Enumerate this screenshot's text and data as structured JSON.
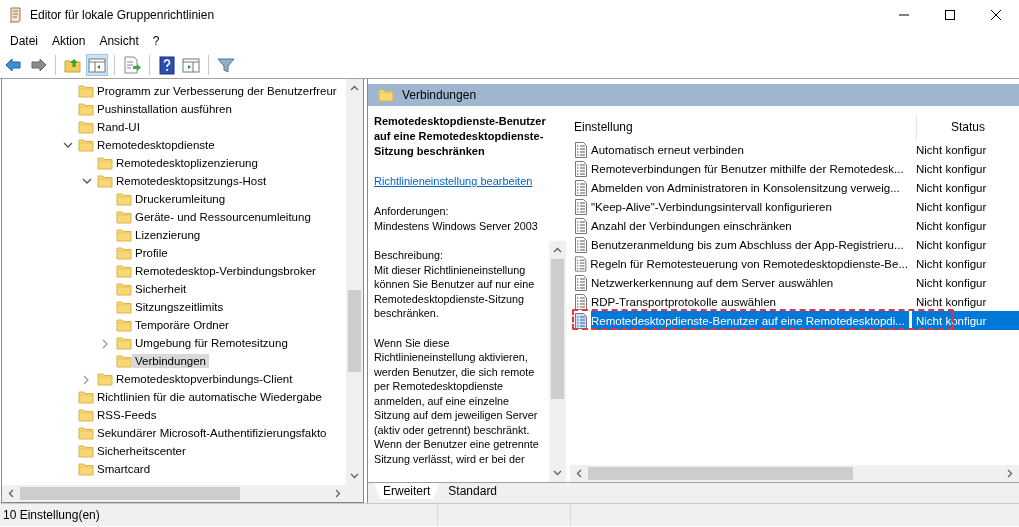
{
  "window": {
    "title": "Editor für lokale Gruppenrichtlinien"
  },
  "menu": [
    "Datei",
    "Aktion",
    "Ansicht",
    "?"
  ],
  "toolbar": [
    {
      "kind": "back"
    },
    {
      "kind": "forward"
    },
    {
      "kind": "sep"
    },
    {
      "kind": "up"
    },
    {
      "kind": "pane",
      "selected": true
    },
    {
      "kind": "sep"
    },
    {
      "kind": "export"
    },
    {
      "kind": "sep"
    },
    {
      "kind": "help"
    },
    {
      "kind": "pane2",
      "selected": false
    },
    {
      "kind": "sep"
    },
    {
      "kind": "filter"
    }
  ],
  "tree": [
    {
      "label": "Programm zur Verbesserung der Benutzerfreur",
      "selected": false
    },
    {
      "label": "Pushinstallation ausführen",
      "selected": false
    },
    {
      "label": "Rand-UI",
      "selected": false
    },
    {
      "label": "Remotedesktopdienste",
      "selected": false,
      "expanded": true,
      "children": [
        {
          "label": "Remotedesktoplizenzierung",
          "selected": false
        },
        {
          "label": "Remotedesktopsitzungs-Host",
          "selected": false,
          "expanded": true,
          "children": [
            {
              "label": "Druckerumleitung",
              "selected": false
            },
            {
              "label": "Geräte- und Ressourcenumleitung",
              "selected": false
            },
            {
              "label": "Lizenzierung",
              "selected": false
            },
            {
              "label": "Profile",
              "selected": false
            },
            {
              "label": "Remotedesktop-Verbindungsbroker",
              "selected": false
            },
            {
              "label": "Sicherheit",
              "selected": false
            },
            {
              "label": "Sitzungszeitlimits",
              "selected": false
            },
            {
              "label": "Temporäre Ordner",
              "selected": false
            },
            {
              "label": "Umgebung für Remotesitzung",
              "selected": false,
              "expanded": false
            },
            {
              "label": "Verbindungen",
              "selected": true
            }
          ]
        },
        {
          "label": "Remotedesktopverbindungs-Client",
          "selected": false,
          "expanded": false
        }
      ]
    },
    {
      "label": "Richtlinien für die automatische Wiedergabe",
      "selected": false
    },
    {
      "label": "RSS-Feeds",
      "selected": false
    },
    {
      "label": "Sekundärer Microsoft-Authentifizierungsfakto",
      "selected": false
    },
    {
      "label": "Sicherheitscenter",
      "selected": false
    },
    {
      "label": "Smartcard",
      "selected": false
    }
  ],
  "panel_header": "Verbindungen",
  "description": {
    "title": "Remotedesktopdienste-Benutzer auf eine Remotedesktopdienste-Sitzung beschränken",
    "link": "Richtlinieneinstellung bearbeiten",
    "paragraphs": [
      "Anforderungen:\nMindestens Windows Server 2003",
      "Beschreibung:\nMit dieser Richtlinieneinstellung können Sie Benutzer auf nur eine Remotedesktopdienste-Sitzung beschränken.",
      "Wenn Sie diese Richtlinieneinstellung aktivieren, werden Benutzer, die sich remote per Remotedesktopdienste anmelden, auf eine einzelne Sitzung auf dem jeweiligen Server (aktiv oder getrennt) beschränkt. Wenn der Benutzer eine getrennte Sitzung verlässt, wird er bei der"
    ]
  },
  "table": {
    "columns": [
      "Einstellung",
      "Status"
    ],
    "rows": [
      {
        "setting": "Automatisch erneut verbinden",
        "status": "Nicht konfigur",
        "selected": false
      },
      {
        "setting": "Remoteverbindungen für Benutzer mithilfe der Remotedesk...",
        "status": "Nicht konfigur",
        "selected": false
      },
      {
        "setting": "Abmelden von Administratoren in Konsolensitzung verweig...",
        "status": "Nicht konfigur",
        "selected": false
      },
      {
        "setting": "\"Keep-Alive\"-Verbindungsintervall konfigurieren",
        "status": "Nicht konfigur",
        "selected": false
      },
      {
        "setting": "Anzahl der Verbindungen einschränken",
        "status": "Nicht konfigur",
        "selected": false
      },
      {
        "setting": "Benutzeranmeldung bis zum Abschluss der App-Registrieru...",
        "status": "Nicht konfigur",
        "selected": false
      },
      {
        "setting": "Regeln für Remotesteuerung von Remotedesktopdienste-Be...",
        "status": "Nicht konfigur",
        "selected": false
      },
      {
        "setting": "Netzwerkerkennung auf dem Server auswählen",
        "status": "Nicht konfigur",
        "selected": false
      },
      {
        "setting": "RDP-Transportprotokolle auswählen",
        "status": "Nicht konfigur",
        "selected": false
      },
      {
        "setting": "Remotedesktopdienste-Benutzer auf eine Remotedesktopdi...",
        "status": "Nicht konfigur",
        "selected": true
      }
    ]
  },
  "tabs": [
    {
      "label": "Erweitert",
      "selected": true
    },
    {
      "label": "Standard",
      "selected": false
    }
  ],
  "status_bar": "10 Einstellung(en)"
}
